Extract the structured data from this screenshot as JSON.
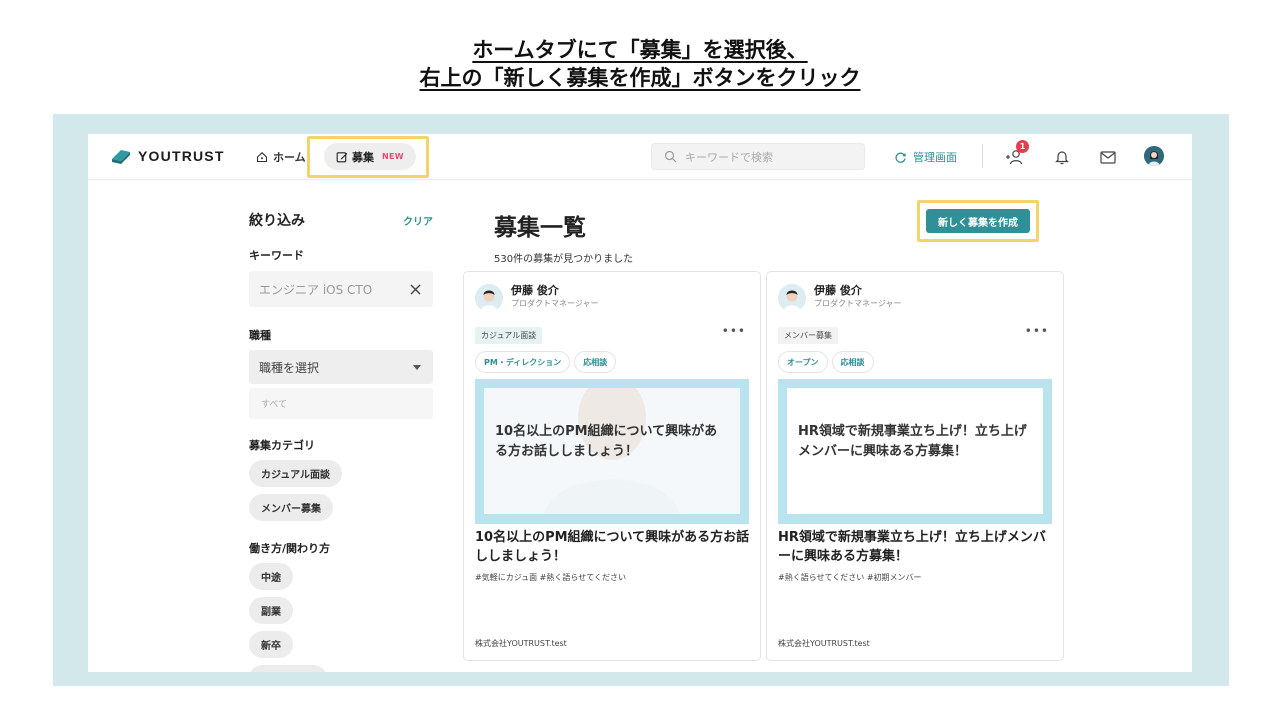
{
  "instruction": {
    "line1": "ホームタブにて「募集」を選択後、",
    "line2": "右上の「新しく募集を作成」ボタンをクリック"
  },
  "header": {
    "logo": "YOUTRUST",
    "nav_home": "ホーム",
    "nav_recruit": "募集",
    "nav_recruit_badge": "NEW",
    "search_placeholder": "キーワードで検索",
    "admin": "管理画面",
    "notification_count": "1"
  },
  "sidebar": {
    "title": "絞り込み",
    "clear": "クリア",
    "keyword_label": "キーワード",
    "keyword_value": "エンジニア iOS CTO",
    "job_label": "職種",
    "job_select": "職種を選択",
    "job_sub": "すべて",
    "category_label": "募集カテゴリ",
    "categories": [
      "カジュアル面談",
      "メンバー募集"
    ],
    "work_label": "働き方/関わり方",
    "work_styles": [
      "中途",
      "副業",
      "新卒"
    ]
  },
  "main": {
    "title": "募集一覧",
    "result_count": "530件の募集が見つかりました",
    "create_button": "新しく募集を作成"
  },
  "cards": [
    {
      "name": "伊藤 俊介",
      "role": "プロダクトマネージャー",
      "category": "カジュアル面談",
      "tags": [
        "PM・ディレクション",
        "応相談"
      ],
      "image_text": "10名以上のPM組織について興味がある方お話ししましょう！",
      "title": "10名以上のPM組織について興味がある方お話ししましょう！",
      "hashtags": "#気軽にカジュ面  #熱く語らせてください",
      "company": "株式会社YOUTRUST.test"
    },
    {
      "name": "伊藤 俊介",
      "role": "プロダクトマネージャー",
      "category": "メンバー募集",
      "tags": [
        "オープン",
        "応相談"
      ],
      "image_text": "HR領域で新規事業立ち上げ！立ち上げメンバーに興味ある方募集！",
      "title": "HR領域で新規事業立ち上げ！立ち上げメンバーに興味ある方募集！",
      "hashtags": "#熱く語らせてください  #初期メンバー",
      "company": "株式会社YOUTRUST.test"
    }
  ],
  "colors": {
    "accent": "#2f9097",
    "highlight": "#f3d36b",
    "frame": "#d3e8ea",
    "badge": "#e2404f"
  }
}
